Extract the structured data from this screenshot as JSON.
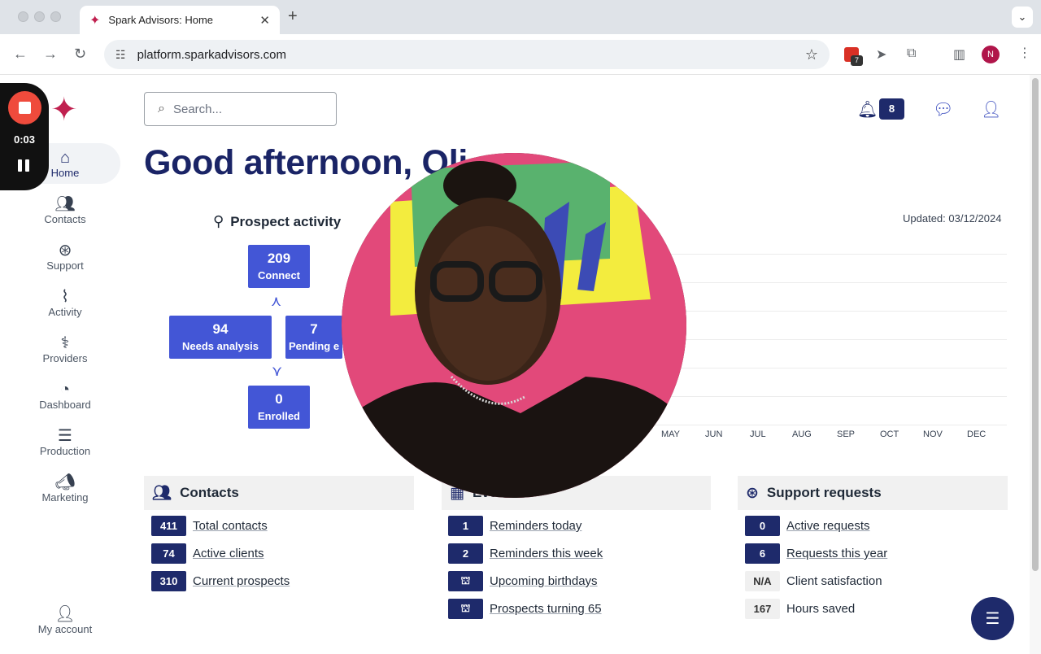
{
  "browser": {
    "tab_title": "Spark Advisors: Home",
    "url": "platform.sparkadvisors.com",
    "ext_badge": "7",
    "profile_initial": "N"
  },
  "recorder": {
    "time": "0:03"
  },
  "sidebar": {
    "items": [
      {
        "label": "Home",
        "icon": "home-icon"
      },
      {
        "label": "Contacts",
        "icon": "users-icon"
      },
      {
        "label": "Support",
        "icon": "lifebuoy-icon"
      },
      {
        "label": "Activity",
        "icon": "activity-icon"
      },
      {
        "label": "Providers",
        "icon": "stethoscope-icon"
      },
      {
        "label": "Dashboard",
        "icon": "gauge-icon"
      },
      {
        "label": "Production",
        "icon": "database-icon"
      },
      {
        "label": "Marketing",
        "icon": "megaphone-icon"
      }
    ],
    "account_label": "My account"
  },
  "header": {
    "search_placeholder": "Search...",
    "notification_count": "8"
  },
  "greeting": "Good afternoon, Oli",
  "prospect_activity": {
    "title": "Prospect activity",
    "updated": "Updated: 03/12/2024",
    "funnel": {
      "connect": {
        "value": "209",
        "label": "Connect"
      },
      "needs_analysis": {
        "value": "94",
        "label": "Needs analysis"
      },
      "pending": {
        "value": "7",
        "label": "Pending e"
      },
      "enrolled": {
        "value": "0",
        "label": "Enrolled"
      }
    },
    "months": [
      "MAY",
      "JUN",
      "JUL",
      "AUG",
      "SEP",
      "OCT",
      "NOV",
      "DEC"
    ]
  },
  "contacts": {
    "title": "Contacts",
    "rows": [
      {
        "count": "411",
        "label": "Total contacts"
      },
      {
        "count": "74",
        "label": "Active clients"
      },
      {
        "count": "310",
        "label": "Current prospects"
      }
    ]
  },
  "events": {
    "title": "Events",
    "rows": [
      {
        "count": "1",
        "label": "Reminders today"
      },
      {
        "count": "2",
        "label": "Reminders this week"
      },
      {
        "count": "",
        "label": "Upcoming birthdays"
      },
      {
        "count": "",
        "label": "Prospects turning 65"
      }
    ]
  },
  "support": {
    "title": "Support requests",
    "rows": [
      {
        "count": "0",
        "label": "Active requests"
      },
      {
        "count": "6",
        "label": "Requests this year"
      },
      {
        "count": "N/A",
        "label": "Client satisfaction"
      },
      {
        "count": "167",
        "label": "Hours saved"
      }
    ]
  }
}
